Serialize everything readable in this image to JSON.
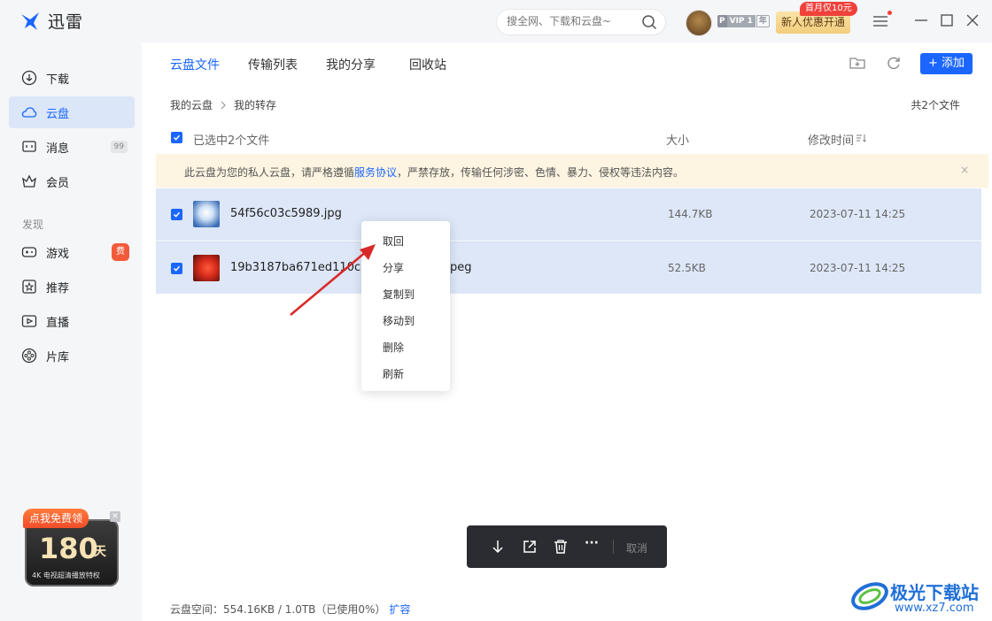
{
  "app": {
    "title": "迅雷"
  },
  "search": {
    "placeholder": "搜全网、下载和云盘~"
  },
  "account": {
    "vip_p": "P",
    "vip_level": "VIP 1",
    "vip_period": "年",
    "promo_badge": "首月仅10元",
    "promo_label": "新人优惠开通"
  },
  "sidebar": {
    "items": [
      {
        "label": "下载"
      },
      {
        "label": "云盘"
      },
      {
        "label": "消息",
        "count": "99"
      },
      {
        "label": "会员"
      }
    ],
    "section_label": "发现",
    "discover": [
      {
        "label": "游戏",
        "badge": "费"
      },
      {
        "label": "推荐"
      },
      {
        "label": "直播"
      },
      {
        "label": "片库"
      }
    ],
    "ad": {
      "top": "点我免费领",
      "num": "180",
      "unit": "天",
      "sub": "4K 电视超清播放特权"
    }
  },
  "tabs": [
    {
      "label": "云盘文件"
    },
    {
      "label": "传输列表"
    },
    {
      "label": "我的分享"
    },
    {
      "label": "回收站"
    }
  ],
  "toolbar": {
    "add_label": "+ 添加"
  },
  "breadcrumb": {
    "root": "我的云盘",
    "current": "我的转存"
  },
  "file_count": "共2个文件",
  "list_header": {
    "selected": "已选中2个文件",
    "size": "大小",
    "modified": "修改时间"
  },
  "notice": {
    "prefix": "此云盘为您的私人云盘，请严格遵循",
    "link": "服务协议",
    "suffix": "，严禁存放，传输任何涉密、色情、暴力、侵权等违法内容。",
    "close": "×"
  },
  "files": [
    {
      "name": "54f56c03c5989.jpg",
      "size": "144.7KB",
      "modified": "2023-07-11 14:25"
    },
    {
      "name": "19b3187ba671ed110c",
      "name_tail": "peg",
      "size": "52.5KB",
      "modified": "2023-07-11 14:25"
    }
  ],
  "context_menu": [
    "取回",
    "分享",
    "复制到",
    "移动到",
    "删除",
    "刷新"
  ],
  "action_bar": {
    "more": "···",
    "cancel": "取消"
  },
  "storage": {
    "text": "云盘空间：554.16KB / 1.0TB（已使用0%）",
    "link": "扩容"
  },
  "watermark": {
    "name": "极光下载站",
    "url": "www.xz7.com"
  },
  "colors": {
    "accent": "#1a66ff",
    "selected_row": "#dde7f8",
    "notice_bg": "#fdf4e1"
  }
}
